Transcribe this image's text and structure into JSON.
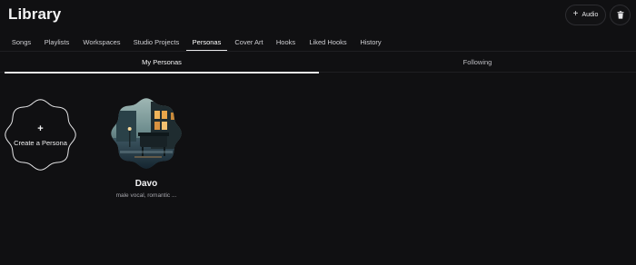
{
  "header": {
    "title": "Library",
    "audio_button_label": "Audio",
    "audio_button_icon": "plus-icon",
    "trash_button_icon": "trash-icon"
  },
  "nav": {
    "tabs": [
      {
        "label": "Songs"
      },
      {
        "label": "Playlists"
      },
      {
        "label": "Workspaces"
      },
      {
        "label": "Studio Projects"
      },
      {
        "label": "Personas"
      },
      {
        "label": "Cover Art"
      },
      {
        "label": "Hooks"
      },
      {
        "label": "Liked Hooks"
      },
      {
        "label": "History"
      }
    ],
    "active": "Personas"
  },
  "subtabs": {
    "items": [
      {
        "label": "My Personas"
      },
      {
        "label": "Following"
      }
    ],
    "active": "My Personas"
  },
  "create_persona": {
    "plus": "+",
    "label": "Create a Persona"
  },
  "personas": [
    {
      "name": "Davo",
      "description": "male vocal, romantic ..."
    }
  ],
  "colors": {
    "background": "#101012",
    "text": "#e8e8ea",
    "muted": "#a6a6ac",
    "border": "#2d2d31"
  }
}
